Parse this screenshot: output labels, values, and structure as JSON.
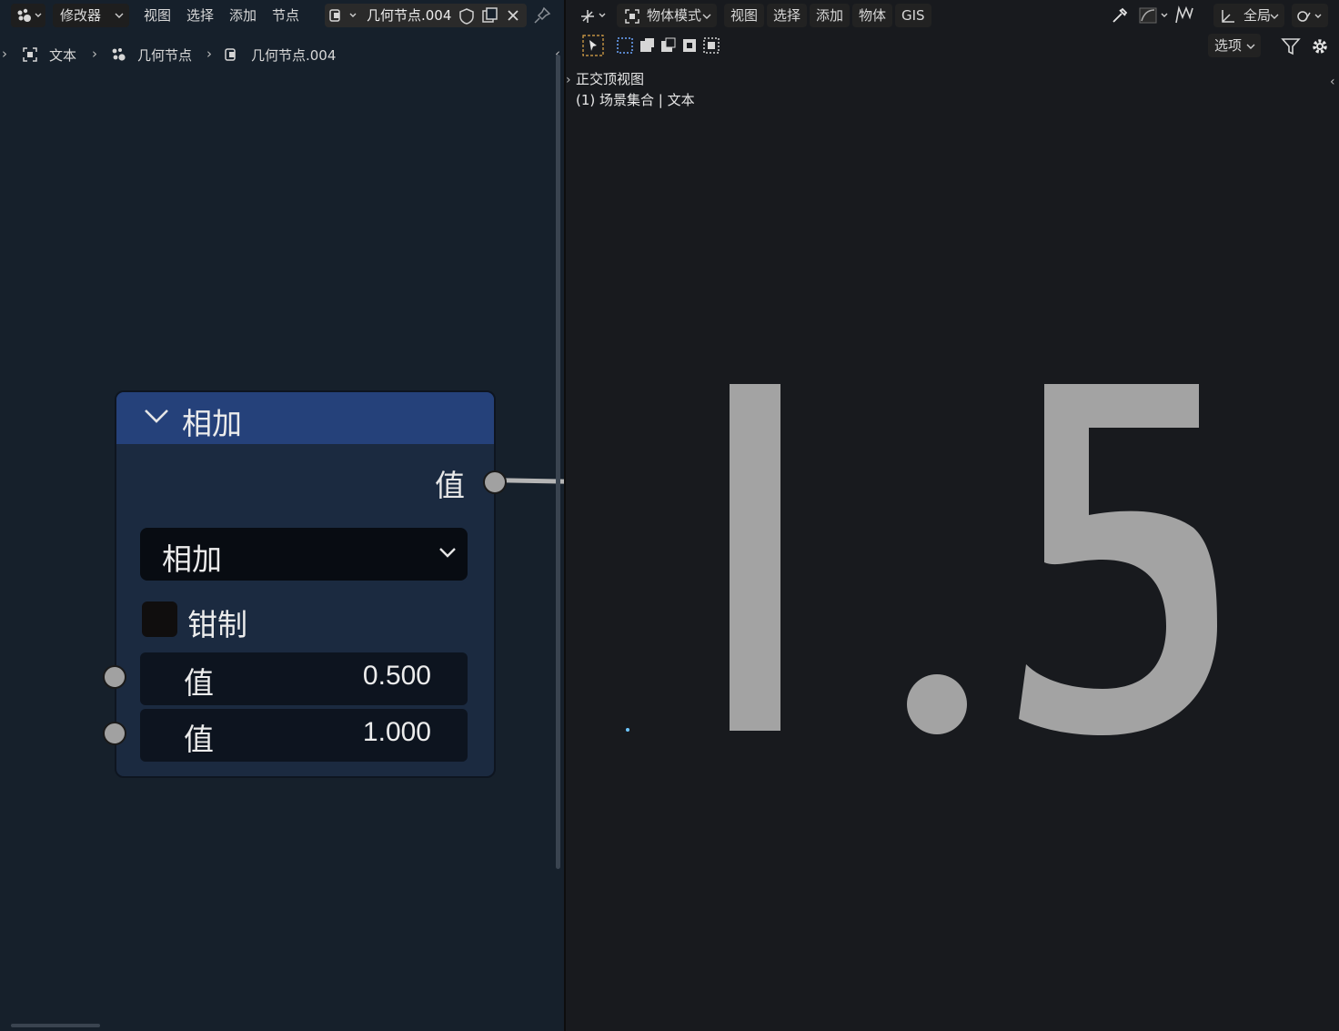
{
  "node_editor": {
    "header": {
      "editor_type_menu": "修改器",
      "menus": [
        "视图",
        "选择",
        "添加",
        "节点"
      ],
      "node_group_name": "几何节点.004"
    },
    "breadcrumb": {
      "object": "文本",
      "modifier": "几何节点",
      "node_group": "几何节点.004"
    },
    "node": {
      "title": "相加",
      "output_label": "值",
      "operation": "相加",
      "clamp_label": "钳制",
      "clamp_checked": false,
      "inputs": [
        {
          "label": "值",
          "value": "0.500"
        },
        {
          "label": "值",
          "value": "1.000"
        }
      ]
    }
  },
  "viewport": {
    "header": {
      "mode": "物体模式",
      "menus": [
        "视图",
        "选择",
        "添加",
        "物体",
        "GIS"
      ],
      "transform_orientation": "全局",
      "options": "选项"
    },
    "overlay": {
      "view_name": "正交顶视图",
      "collection_info": "(1) 场景集合 | 文本"
    },
    "text_object": "1.5"
  },
  "colors": {
    "node_header": "#25417a",
    "node_body": "#1b2a40",
    "editor_bg": "#16202b",
    "viewport_bg": "#181a1e",
    "text_object": "#a3a3a3",
    "socket": "#a1a1a1"
  }
}
